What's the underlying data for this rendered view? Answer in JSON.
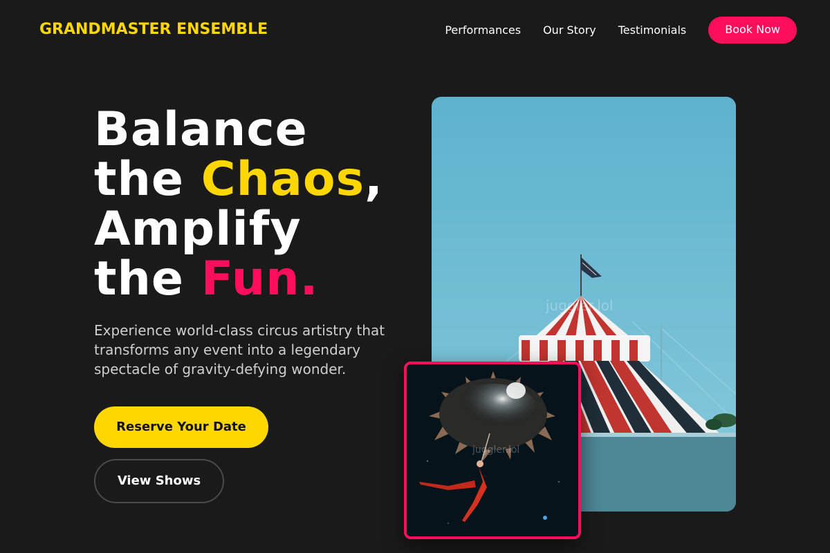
{
  "brand": {
    "name": "GRANDMASTER ENSEMBLE"
  },
  "nav": {
    "links": [
      "Performances",
      "Our Story",
      "Testimonials"
    ],
    "cta": "Book Now"
  },
  "hero": {
    "line1": "Balance",
    "line2_prefix": "the ",
    "line2_highlight": "Chaos",
    "line2_suffix": ",",
    "line3": "Amplify",
    "line4_prefix": "the ",
    "line4_highlight": "Fun.",
    "lead": "Experience world-class circus artistry that transforms any event into a legendary spectacle of gravity-defying wonder.",
    "primary_button": "Reserve Your Date",
    "secondary_button": "View Shows"
  },
  "images": {
    "main_watermark": "juggler.lol",
    "inset_watermark": "juggler.lol"
  },
  "colors": {
    "accent_yellow": "#FFD700",
    "accent_pink": "#FF0F5B",
    "background": "#1a1a1a"
  }
}
